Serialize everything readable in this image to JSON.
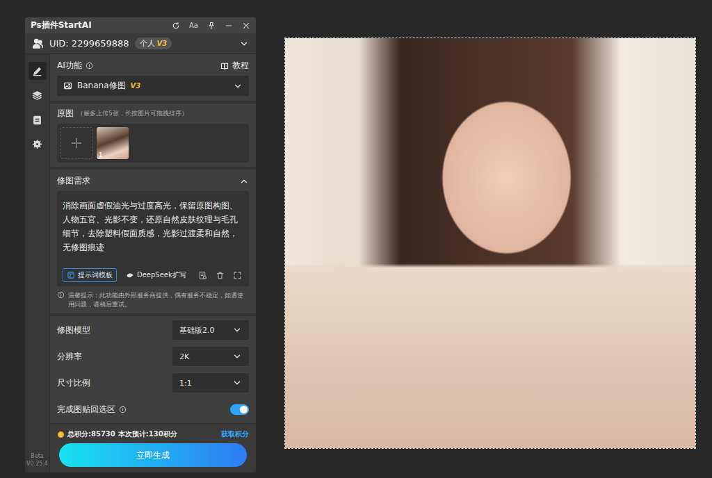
{
  "window": {
    "title": "Ps插件StartAI",
    "font_button": "Aa"
  },
  "account": {
    "uid": "UID: 2299659888",
    "badge": "个人",
    "badge_version": "V3"
  },
  "sidebar": {
    "items": [
      {
        "kind": "pencil",
        "selected": true
      },
      {
        "kind": "layers",
        "selected": false
      },
      {
        "kind": "clipboard",
        "selected": false
      },
      {
        "kind": "gear",
        "selected": false
      }
    ],
    "beta": "Beta",
    "version": "V0.25.4"
  },
  "ai_function": {
    "label": "AI功能",
    "tutorial": "教程",
    "tool": "Banana修图",
    "tool_version": "V3"
  },
  "source_images": {
    "label": "原图",
    "hint": "（最多上传5张，长按图片可拖拽排序）",
    "images": [
      {
        "index": "1"
      }
    ]
  },
  "prompt": {
    "label": "修图需求",
    "expanded": true,
    "text": "消除画面虚假油光与过度高光，保留原图构图、人物五官、光影不变，还原自然皮肤纹理与毛孔细节，去除塑料假面质感，光影过渡柔和自然，无修图痕迹",
    "actions": [
      {
        "label": "提示词模板",
        "kind": "template"
      },
      {
        "label": "DeepSeek扩写",
        "kind": "deepseek"
      }
    ]
  },
  "notice": "温馨提示：此功能由外部服务商提供，偶有服务不稳定，如遇使用问题，请稍后重试。",
  "settings": [
    {
      "kind": "select",
      "label": "修图模型",
      "value": "基础版2.0"
    },
    {
      "kind": "select",
      "label": "分辨率",
      "value": "2K"
    },
    {
      "kind": "select",
      "label": "尺寸比例",
      "value": "1:1"
    },
    {
      "kind": "toggle",
      "label": "完成图贴回选区",
      "on": true
    }
  ],
  "points": {
    "total": "总积分:85730",
    "estimate": "本次预计:130积分",
    "get": "获取积分"
  },
  "generate_button": "立即生成",
  "canvas": {
    "selection_active": true
  }
}
